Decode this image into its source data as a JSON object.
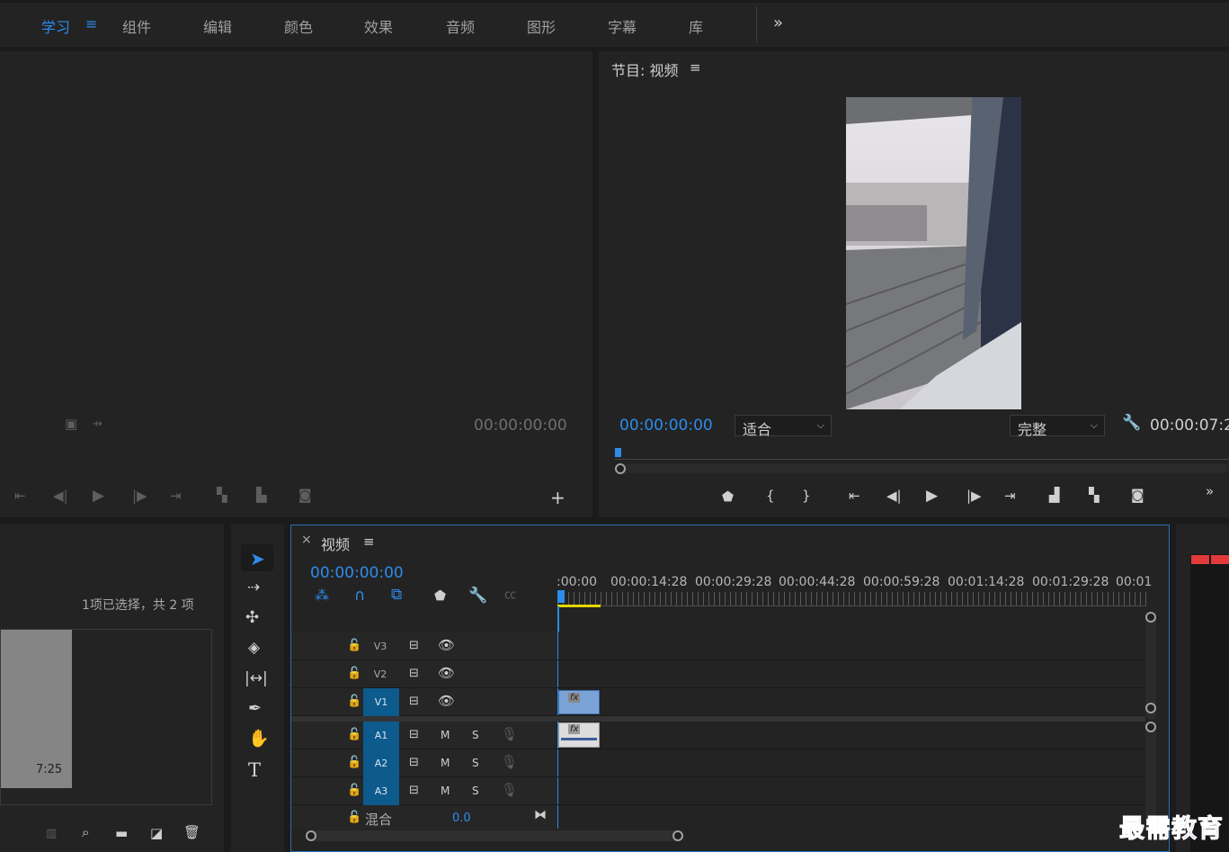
{
  "nav": {
    "tabs": [
      "学习",
      "组件",
      "编辑",
      "颜色",
      "效果",
      "音频",
      "图形",
      "字幕",
      "库"
    ],
    "active_tab": "学习",
    "more_label": "»"
  },
  "source_monitor": {
    "timecode": "00:00:00:00"
  },
  "program_monitor": {
    "title": "节目: 视频",
    "timecode": "00:00:00:00",
    "zoom_select": "适合",
    "quality_select": "完整",
    "duration": "00:00:07:2"
  },
  "project": {
    "selection_status": "1项已选择，共 2 项",
    "thumb_duration": "7:25"
  },
  "timeline": {
    "tab_title": "视频",
    "close_label": "×",
    "timecode": "00:00:00:00",
    "ruler_labels": [
      ":00:00",
      "00:00:14:28",
      "00:00:29:28",
      "00:00:44:28",
      "00:00:59:28",
      "00:01:14:28",
      "00:01:29:28",
      "00:01"
    ],
    "video_tracks": [
      "V3",
      "V2",
      "V1"
    ],
    "audio_tracks": [
      "A1",
      "A2",
      "A3"
    ],
    "mute_label": "M",
    "solo_label": "S",
    "mix_label": "混合",
    "mix_value": "0.0",
    "fx_label": "fx"
  },
  "tools": {
    "type_tool": "T"
  },
  "watermark": "最需教育",
  "colors": {
    "accent": "#2d8ceb",
    "track_target": "#0d5a8c",
    "clip": "#7ba3d8",
    "work_area": "#e6d600",
    "meter_red": "#e23a3a"
  }
}
